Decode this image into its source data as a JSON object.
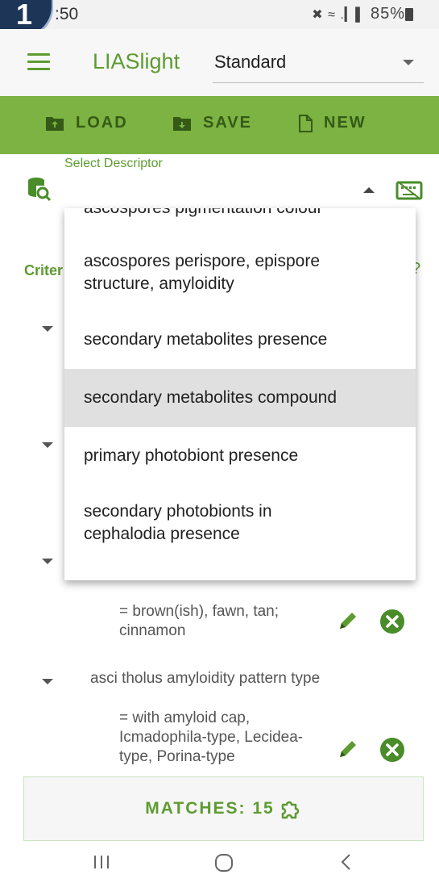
{
  "status": {
    "time": ":50",
    "icons": "✖︎ ≈ .▎▌",
    "battery": "85%"
  },
  "badge": {
    "number": "1"
  },
  "appbar": {
    "title": "LIASlight",
    "mode_value": "Standard"
  },
  "toolbar": {
    "load": "LOAD",
    "save": "SAVE",
    "new": "NEW"
  },
  "descriptor": {
    "label": "Select Descriptor"
  },
  "criteria": {
    "label_fragment": "Criter",
    "help_fragment": "?"
  },
  "dropdown": {
    "partial": "ascospores pigmentation colour",
    "options": [
      "ascospores perispore, epispore structure, amyloidity",
      "secondary metabolites presence",
      "secondary metabolites compound",
      "primary photobiont presence",
      "secondary photobionts in cephalodia presence"
    ],
    "selected_index": 2
  },
  "items": {
    "value1": "= brown(ish), fawn, tan; cinnamon",
    "desc2": "asci tholus amyloidity pattern type",
    "value2": "= with amyloid cap, Icmadophila-type, Lecidea-type, Porina-type"
  },
  "matches": {
    "label": "MATCHES: 15"
  },
  "colors": {
    "brand_green": "#7cb342",
    "text_green": "#5d9b30",
    "delete_green": "#4a8c2a"
  }
}
